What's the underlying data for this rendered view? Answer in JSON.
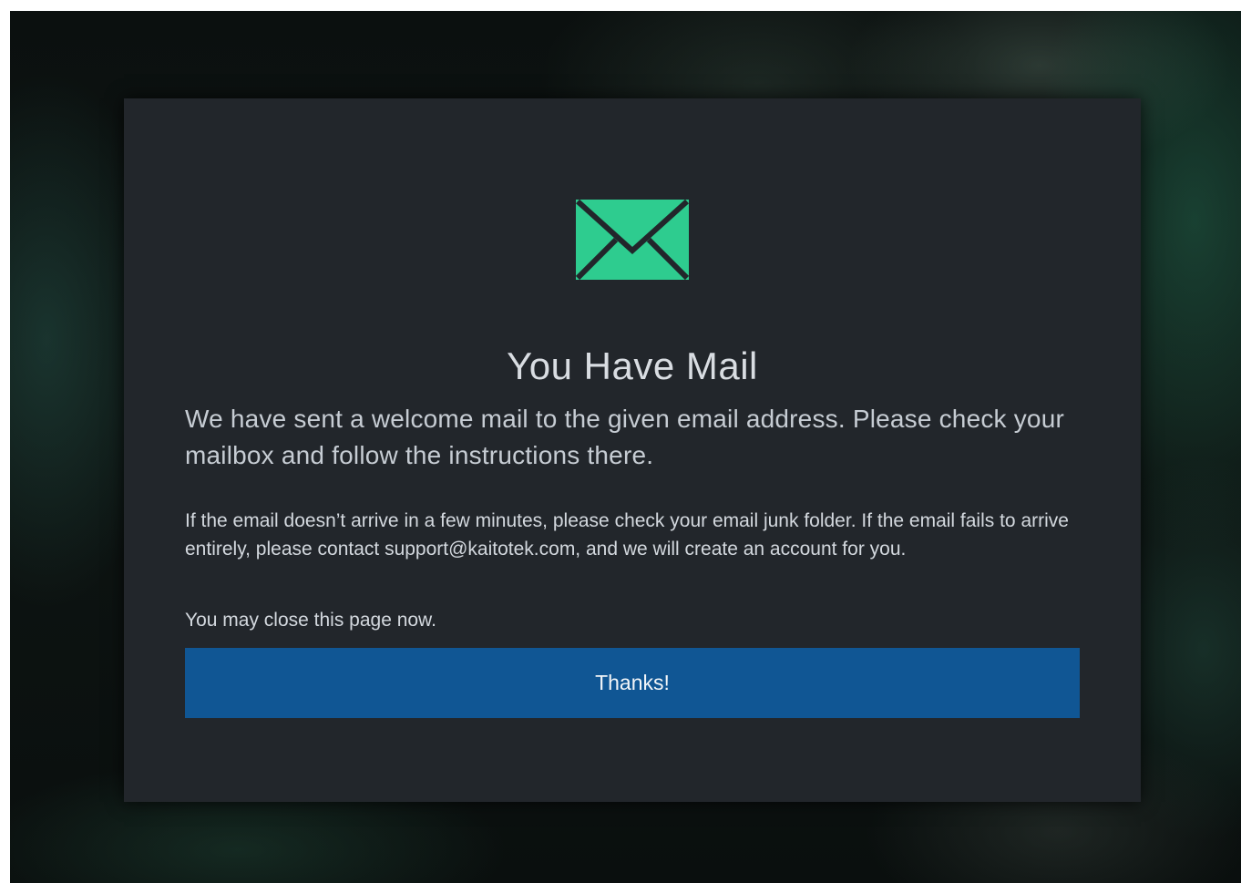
{
  "dialog": {
    "icon": "envelope-icon",
    "title": "You Have Mail",
    "lead": "We have sent a welcome mail to the given email address. Please check your mailbox and follow the instructions there.",
    "info": "If the email doesn’t arrive in a few minutes, please check your email junk folder. If the email fails to arrive entirely, please contact support@kaitotek.com, and we will create an account for you.",
    "close_note": "You may close this page now.",
    "button_label": "Thanks!"
  },
  "colors": {
    "accent_green": "#2ecc8f",
    "button_blue": "#105694",
    "card_background": "#22262b"
  }
}
